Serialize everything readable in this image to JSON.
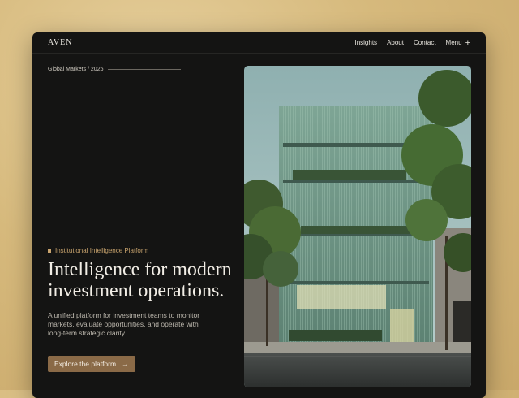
{
  "brand": {
    "logo": "AVEN"
  },
  "nav": {
    "links": [
      "Insights",
      "About",
      "Contact"
    ],
    "menu_label": "Menu",
    "menu_icon": "plus-icon"
  },
  "hero": {
    "eyebrow": "Global Markets / 2026",
    "tag": "Institutional Intelligence Platform",
    "headline": "Intelligence for modern investment operations.",
    "description": "A unified platform for investment teams to monitor markets, evaluate opportunities, and operate with long-term strategic clarity.",
    "cta_label": "Explore the platform",
    "cta_icon": "arrow-right-icon"
  },
  "colors": {
    "background": "#141413",
    "accent": "#c9a46e",
    "cta": "#8a6a47",
    "page": "#d6b97c"
  }
}
